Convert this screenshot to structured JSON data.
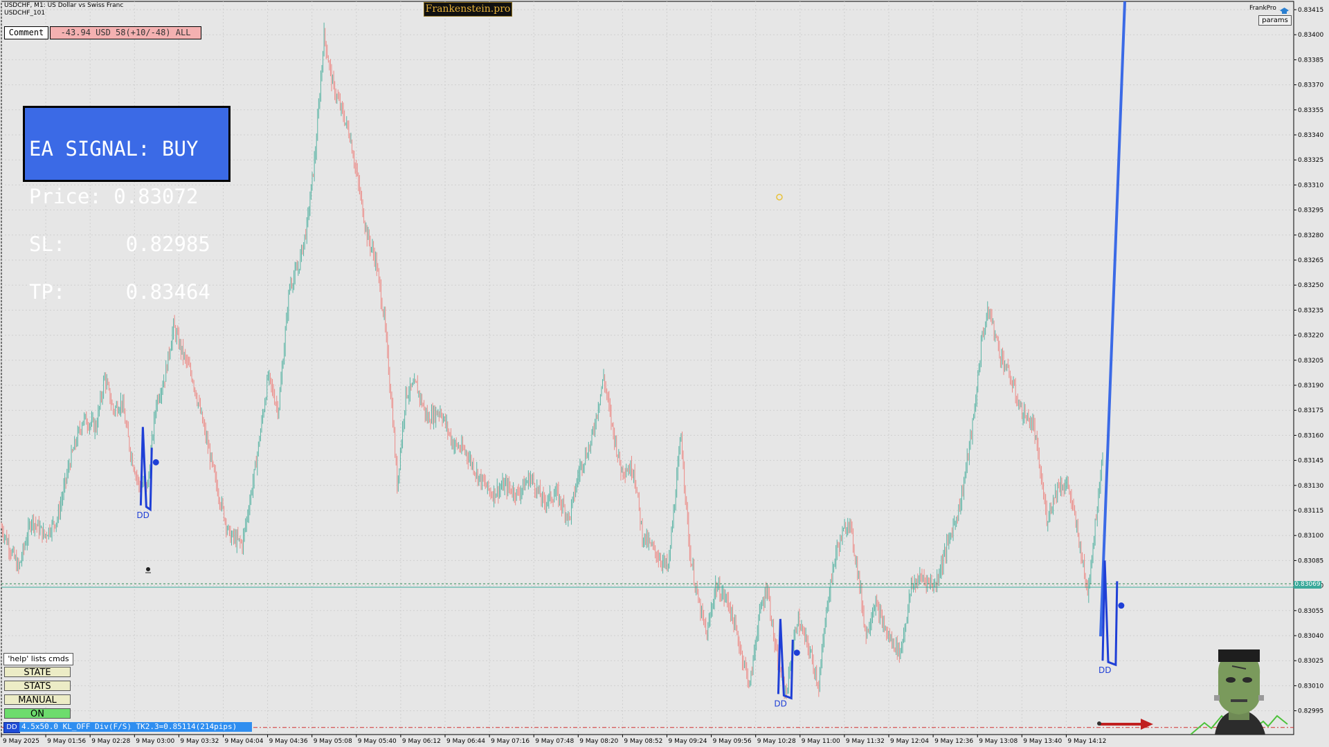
{
  "header": {
    "symbol_line": "USDCHF, M1:  US Dollar vs Swiss Franc",
    "chart_name": "USDCHF_101",
    "brand": "Frankenstein.pro",
    "user": "FrankPro",
    "params_label": "params"
  },
  "comment": {
    "label": "Comment",
    "value": "-43.94 USD 58(+10/-48) ALL"
  },
  "signal": {
    "line1": "EA SIGNAL: BUY",
    "line2": "Price: 0.83072",
    "line3": "SL:     0.82985",
    "line4": "TP:     0.83464"
  },
  "panel": {
    "help": "'help' lists cmds",
    "state": "STATE",
    "stats": "STATS",
    "manual": "MANUAL",
    "on": "ON"
  },
  "status_bar": {
    "dd": "DD",
    "text": "4.5x50.0 KL_OFF Div(F/S) TK2.3=0.85114(214pips)"
  },
  "markers": {
    "dd_label": "DD"
  },
  "price_axis": {
    "current_price": "0.83069",
    "labels": [
      "0.83415",
      "0.83400",
      "0.83385",
      "0.83370",
      "0.83355",
      "0.83340",
      "0.83325",
      "0.83310",
      "0.83295",
      "0.83280",
      "0.83265",
      "0.83250",
      "0.83235",
      "0.83220",
      "0.83205",
      "0.83190",
      "0.83175",
      "0.83160",
      "0.83145",
      "0.83130",
      "0.83115",
      "0.83100",
      "0.83085",
      "0.83070",
      "0.83055",
      "0.83040",
      "0.83025",
      "0.83010",
      "0.82995"
    ]
  },
  "time_axis": {
    "labels": [
      "9 May 2025",
      "9 May 01:56",
      "9 May 02:28",
      "9 May 03:00",
      "9 May 03:32",
      "9 May 04:04",
      "9 May 04:36",
      "9 May 05:08",
      "9 May 05:40",
      "9 May 06:12",
      "9 May 06:44",
      "9 May 07:16",
      "9 May 07:48",
      "9 May 08:20",
      "9 May 08:52",
      "9 May 09:24",
      "9 May 09:56",
      "9 May 10:28",
      "9 May 11:00",
      "9 May 11:32",
      "9 May 12:04",
      "9 May 12:36",
      "9 May 13:08",
      "9 May 13:40",
      "9 May 14:12"
    ]
  },
  "chart_data": {
    "type": "candlestick",
    "symbol": "USDCHF",
    "timeframe": "M1",
    "ylim": [
      0.8299,
      0.8342
    ],
    "current_price": 0.83069,
    "sl": 0.82985,
    "tp": 0.83464,
    "path": [
      [
        0,
        0.83105
      ],
      [
        8,
        0.83095
      ],
      [
        20,
        0.8308
      ],
      [
        35,
        0.8311
      ],
      [
        50,
        0.831
      ],
      [
        65,
        0.8311
      ],
      [
        80,
        0.83145
      ],
      [
        95,
        0.8317
      ],
      [
        110,
        0.83165
      ],
      [
        120,
        0.83195
      ],
      [
        130,
        0.83175
      ],
      [
        140,
        0.8318
      ],
      [
        150,
        0.8315
      ],
      [
        160,
        0.8313
      ],
      [
        170,
        0.8313
      ],
      [
        180,
        0.8318
      ],
      [
        190,
        0.83195
      ],
      [
        200,
        0.83225
      ],
      [
        210,
        0.8321
      ],
      [
        222,
        0.83195
      ],
      [
        235,
        0.83165
      ],
      [
        250,
        0.8313
      ],
      [
        265,
        0.831
      ],
      [
        280,
        0.83095
      ],
      [
        295,
        0.8314
      ],
      [
        310,
        0.83195
      ],
      [
        322,
        0.83175
      ],
      [
        335,
        0.8325
      ],
      [
        345,
        0.8326
      ],
      [
        355,
        0.83285
      ],
      [
        365,
        0.8333
      ],
      [
        375,
        0.834
      ],
      [
        385,
        0.8337
      ],
      [
        395,
        0.83355
      ],
      [
        405,
        0.8334
      ],
      [
        415,
        0.8331
      ],
      [
        425,
        0.8328
      ],
      [
        435,
        0.83265
      ],
      [
        445,
        0.8323
      ],
      [
        455,
        0.8317
      ],
      [
        460,
        0.8313
      ],
      [
        470,
        0.83185
      ],
      [
        482,
        0.8319
      ],
      [
        495,
        0.8317
      ],
      [
        510,
        0.83175
      ],
      [
        525,
        0.83155
      ],
      [
        540,
        0.8315
      ],
      [
        555,
        0.83135
      ],
      [
        570,
        0.83125
      ],
      [
        585,
        0.8313
      ],
      [
        600,
        0.83125
      ],
      [
        615,
        0.83135
      ],
      [
        630,
        0.8312
      ],
      [
        645,
        0.83125
      ],
      [
        660,
        0.8311
      ],
      [
        672,
        0.8314
      ],
      [
        685,
        0.83155
      ],
      [
        700,
        0.83195
      ],
      [
        710,
        0.83165
      ],
      [
        720,
        0.8314
      ],
      [
        735,
        0.8314
      ],
      [
        745,
        0.831
      ],
      [
        760,
        0.8309
      ],
      [
        775,
        0.8308
      ],
      [
        790,
        0.8316
      ],
      [
        800,
        0.8309
      ],
      [
        810,
        0.8306
      ],
      [
        820,
        0.8304
      ],
      [
        830,
        0.8307
      ],
      [
        845,
        0.8306
      ],
      [
        860,
        0.8303
      ],
      [
        870,
        0.8301
      ],
      [
        880,
        0.8305
      ],
      [
        890,
        0.8307
      ],
      [
        900,
        0.8303
      ],
      [
        912,
        0.83005
      ],
      [
        925,
        0.8305
      ],
      [
        940,
        0.8303
      ],
      [
        950,
        0.8301
      ],
      [
        960,
        0.8306
      ],
      [
        970,
        0.8309
      ],
      [
        985,
        0.8311
      ],
      [
        995,
        0.8308
      ],
      [
        1005,
        0.8304
      ],
      [
        1015,
        0.8306
      ],
      [
        1030,
        0.8304
      ],
      [
        1045,
        0.8303
      ],
      [
        1058,
        0.8307
      ],
      [
        1070,
        0.83075
      ],
      [
        1085,
        0.8307
      ],
      [
        1100,
        0.83095
      ],
      [
        1115,
        0.8312
      ],
      [
        1130,
        0.8317
      ],
      [
        1140,
        0.8322
      ],
      [
        1148,
        0.83235
      ],
      [
        1160,
        0.8321
      ],
      [
        1172,
        0.83195
      ],
      [
        1185,
        0.83175
      ],
      [
        1200,
        0.83165
      ],
      [
        1215,
        0.8311
      ],
      [
        1228,
        0.8313
      ],
      [
        1240,
        0.8313
      ],
      [
        1255,
        0.8309
      ],
      [
        1262,
        0.83065
      ],
      [
        1270,
        0.831
      ],
      [
        1280,
        0.8315
      ]
    ],
    "markers": [
      {
        "type": "DD",
        "t": [
          162,
          178
        ],
        "range": [
          0.83165,
          0.83118
        ]
      },
      {
        "type": "DD",
        "t": [
          903,
          923
        ],
        "range": [
          0.8305,
          0.83005
        ]
      },
      {
        "type": "DD",
        "t": [
          1280,
          1300
        ],
        "range": [
          0.83085,
          0.83025
        ]
      }
    ]
  }
}
